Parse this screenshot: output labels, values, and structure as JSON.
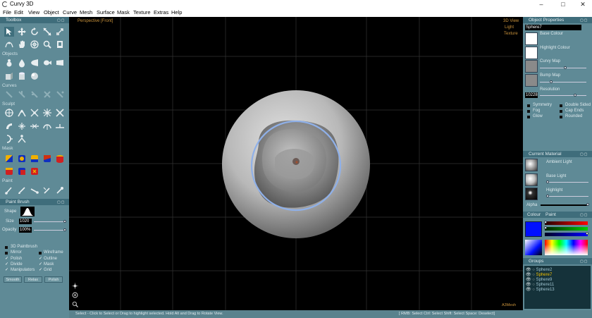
{
  "window": {
    "title": "Curvy 3D"
  },
  "menu": [
    "File",
    "Edit",
    "View",
    "Object",
    "Curve",
    "Mesh",
    "Surface",
    "Mask",
    "Texture",
    "Extras",
    "Help"
  ],
  "toolbox": {
    "title": "Toolbox",
    "sections": {
      "objects": "Objects",
      "curves": "Curves",
      "sculpt": "Sculpt",
      "mask": "Mask",
      "paint": "Paint"
    }
  },
  "paint_brush": {
    "title": "Paint Brush",
    "shape_label": "Shape",
    "size_label": "Size",
    "size_value": "1020",
    "opacity_label": "Opacity",
    "opacity_value": "100%",
    "checks": [
      "3D Paintbrush",
      "Mirror",
      "Wireframe",
      "Polish",
      "Outline",
      "Divide",
      "Mask",
      "Manipulators",
      "Grid"
    ],
    "buttons": [
      "Smooth",
      "Relax",
      "Polish"
    ]
  },
  "viewport": {
    "label_tl": "Perspective [Front]",
    "label_tr": [
      "3D View",
      "Light",
      "Texture"
    ],
    "label_br": "A3Mesh"
  },
  "status": {
    "left": "Select - Click to Select or Drag to highlight selected. Hold Alt and Drag to Rotate View.",
    "right": "[ RMB: Select   Ctrl: Select   Shift: Select   Space: Deselect]"
  },
  "object_properties": {
    "title": "Object Properties",
    "name": "Sphere7",
    "base_colour": "Base Colour",
    "highlight_colour": "Highlight Colour",
    "curvy_map": "Curvy Map",
    "bump_map": "Bump Map",
    "resolution_label": "Resolution",
    "resolution_value": "10228",
    "options": [
      "Symmetry",
      "Double Sided",
      "Fog",
      "Cap Ends",
      "Glow",
      "Rounded"
    ]
  },
  "material": {
    "title": "Current Material",
    "ambient": "Ambient Light",
    "base_light": "Base Light",
    "highlight": "Highlight",
    "alpha": "Alpha"
  },
  "colour": {
    "tab_colour": "Colour",
    "tab_paint": "Paint",
    "accent": "#0010ff"
  },
  "groups": {
    "title": "Groups",
    "items": [
      "Sphere2",
      "Sphere7",
      "Sphere9",
      "Sphere11",
      "Sphere13"
    ],
    "selected_index": 1
  }
}
